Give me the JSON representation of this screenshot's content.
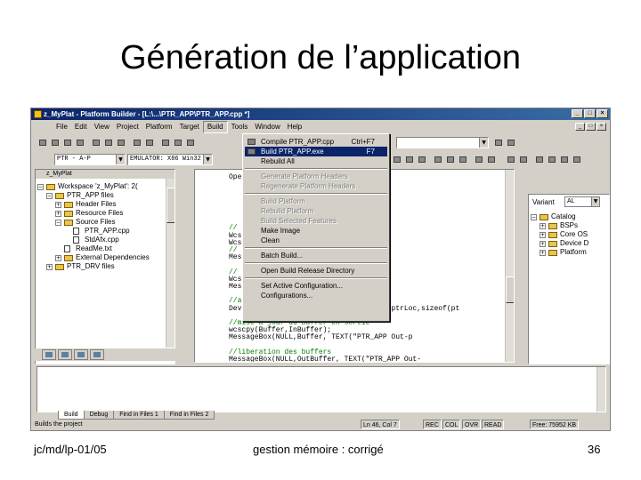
{
  "slide": {
    "title": "Génération de l’application",
    "footer_left": "jc/md/lp-01/05",
    "footer_center": "gestion mémoire : corrigé",
    "page_number": "36"
  },
  "window": {
    "title": "z_MyPlat - Platform Builder - [L:\\...\\PTR_APP\\PTR_APP.cpp *]",
    "buttons": [
      "_",
      "□",
      "×"
    ]
  },
  "menubar": {
    "items": [
      "File",
      "Edit",
      "View",
      "Project",
      "Platform",
      "Target",
      "Build",
      "Tools",
      "Window",
      "Help"
    ],
    "active_index": 6
  },
  "toolbar": {
    "config_combo": "PTR - A-P",
    "platform_combo": "EMULATOR: X86 Win32",
    "catalog_combo": "AL"
  },
  "build_menu": {
    "items": [
      {
        "label": "Compile PTR_APP.cpp",
        "shortcut": "Ctrl+F7",
        "state": "normal"
      },
      {
        "label": "Build PTR_APP.exe",
        "shortcut": "F7",
        "state": "selected"
      },
      {
        "label": "Rebuild All",
        "shortcut": "",
        "state": "normal"
      },
      {
        "label": "sep"
      },
      {
        "label": "Generate Platform Headers",
        "shortcut": "",
        "state": "disabled"
      },
      {
        "label": "Regenerate Platform Headers",
        "shortcut": "",
        "state": "disabled"
      },
      {
        "label": "sep"
      },
      {
        "label": "Build Platform",
        "shortcut": "",
        "state": "disabled"
      },
      {
        "label": "Rebuild Platform",
        "shortcut": "",
        "state": "disabled"
      },
      {
        "label": "Build Selected Features",
        "shortcut": "",
        "state": "disabled"
      },
      {
        "label": "Make Image",
        "shortcut": "",
        "state": "normal"
      },
      {
        "label": "Clean",
        "shortcut": "",
        "state": "normal"
      },
      {
        "label": "sep"
      },
      {
        "label": "Batch Build...",
        "shortcut": "",
        "state": "normal"
      },
      {
        "label": "sep"
      },
      {
        "label": "Open Build Release Directory",
        "shortcut": "",
        "state": "normal"
      },
      {
        "label": "sep"
      },
      {
        "label": "Set Active Configuration...",
        "shortcut": "",
        "state": "normal"
      },
      {
        "label": "Configurations...",
        "shortcut": "",
        "state": "normal"
      }
    ]
  },
  "workspace": {
    "header": "z_MyPlat",
    "tree": [
      {
        "label": "Workspace 'z_MyPlat': 2(",
        "level": 0,
        "kind": "root",
        "exp": "−"
      },
      {
        "label": "PTR_APP files",
        "level": 1,
        "kind": "folder",
        "exp": "−"
      },
      {
        "label": "Header Files",
        "level": 2,
        "kind": "folder",
        "exp": "+"
      },
      {
        "label": "Resource Files",
        "level": 2,
        "kind": "folder",
        "exp": "+"
      },
      {
        "label": "Source Files",
        "level": 2,
        "kind": "folder",
        "exp": "−"
      },
      {
        "label": "PTR_APP.cpp",
        "level": 3,
        "kind": "file",
        "exp": ""
      },
      {
        "label": "StdAfx.cpp",
        "level": 3,
        "kind": "file",
        "exp": ""
      },
      {
        "label": "ReadMe.txt",
        "level": 2,
        "kind": "file",
        "exp": ""
      },
      {
        "label": "External Dependencies",
        "level": 2,
        "kind": "folder",
        "exp": "+"
      },
      {
        "label": "PTR_DRV files",
        "level": 1,
        "kind": "folder",
        "exp": "+"
      }
    ]
  },
  "editor": {
    "lines": [
      {
        "text": "Open driver: \"),  TEXT(\"PTR_AP",
        "type": "code"
      },
      {
        "text": "",
        "type": "code"
      },
      {
        "text": "",
        "type": "code"
      },
      {
        "text": "",
        "type": "code"
      },
      {
        "text": "",
        "type": "code"
      },
      {
        "text": "",
        "type": "code"
      },
      {
        "text": "",
        "type": "code"
      },
      {
        "text": "//        ers",
        "type": "comment"
      },
      {
        "text": "Wcs             AR QUE COUCOU DANS APPLIC",
        "type": "code"
      },
      {
        "text": "Wcs             (\"EEEEEEEEEEEEEEEEE\"));",
        "type": "code"
      },
      {
        "text": "//              tie",
        "type": "comment"
      },
      {
        "text": "Mes             uffer, TEXT(\"PTR_APP OutBu",
        "type": "code"
      },
      {
        "text": "",
        "type": "code"
      },
      {
        "text": "//              les buffers avant RETAINING",
        "type": "comment"
      },
      {
        "text": "Wcs             InBuffer avant remplissag",
        "type": "code"
      },
      {
        "text": "Mes             OutBuffer avant remplissag",
        "type": "code"
      },
      {
        "text": "",
        "type": "code"
      },
      {
        "text": "//appel de l'IOCTL",
        "type": "comment"
      },
      {
        "text": "DeviceIoControl(hPtr,IOCTL_POINTEURS,SptrLoc,sizeof(pt",
        "type": "code"
      },
      {
        "text": "",
        "type": "code"
      },
      {
        "text": "//mise a jour du buffer en sortie",
        "type": "comment"
      },
      {
        "text": "wcscpy(Buffer,InBuffer);",
        "type": "code"
      },
      {
        "text": "MessageBox(NULL,Buffer, TEXT(\"PTR_APP Out-p",
        "type": "code"
      },
      {
        "text": "",
        "type": "code"
      },
      {
        "text": "//liberation des buffers",
        "type": "comment"
      },
      {
        "text": "MessageBox(NULL,OutBuffer, TEXT(\"PTR_APP Out-",
        "type": "code"
      }
    ]
  },
  "catalog": {
    "label": "Variant",
    "tree": [
      {
        "label": "Catalog",
        "level": 0,
        "exp": "−"
      },
      {
        "label": "BSPs",
        "level": 1,
        "exp": "+"
      },
      {
        "label": "Core OS",
        "level": 1,
        "exp": "+"
      },
      {
        "label": "Device D",
        "level": 1,
        "exp": "+"
      },
      {
        "label": "Platform",
        "level": 1,
        "exp": "+"
      }
    ]
  },
  "output_tabs": [
    "Build",
    "Debug",
    "Find in Files 1",
    "Find in Files 2"
  ],
  "statusbar": {
    "text": "Builds the project",
    "position": "Ln 46, Col 7",
    "cells": [
      "REC",
      "COL",
      "OVR",
      "READ"
    ],
    "memory": "Free: 75952 KB"
  }
}
